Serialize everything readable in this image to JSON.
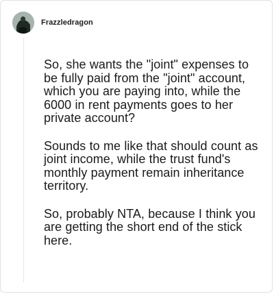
{
  "post": {
    "username": "Frazzledragon",
    "paragraphs": [
      "So, she wants the \"joint\" expenses to be fully paid from the \"joint\" account, which you are paying into, while the 6000 in rent payments goes to her private account?",
      "Sounds to me like that should count as joint income, while the trust fund's monthly payment remain inheritance territory.",
      "So, probably NTA, because I think you are getting the short end of the stick here."
    ]
  },
  "icons": {
    "avatar": "user-avatar-icon"
  },
  "colors": {
    "background": "#ffffff",
    "text": "#1a1a1b",
    "border": "#dfe1e3",
    "thread_line": "#e4e6e8",
    "avatar_bg": "#a7b3ad"
  }
}
